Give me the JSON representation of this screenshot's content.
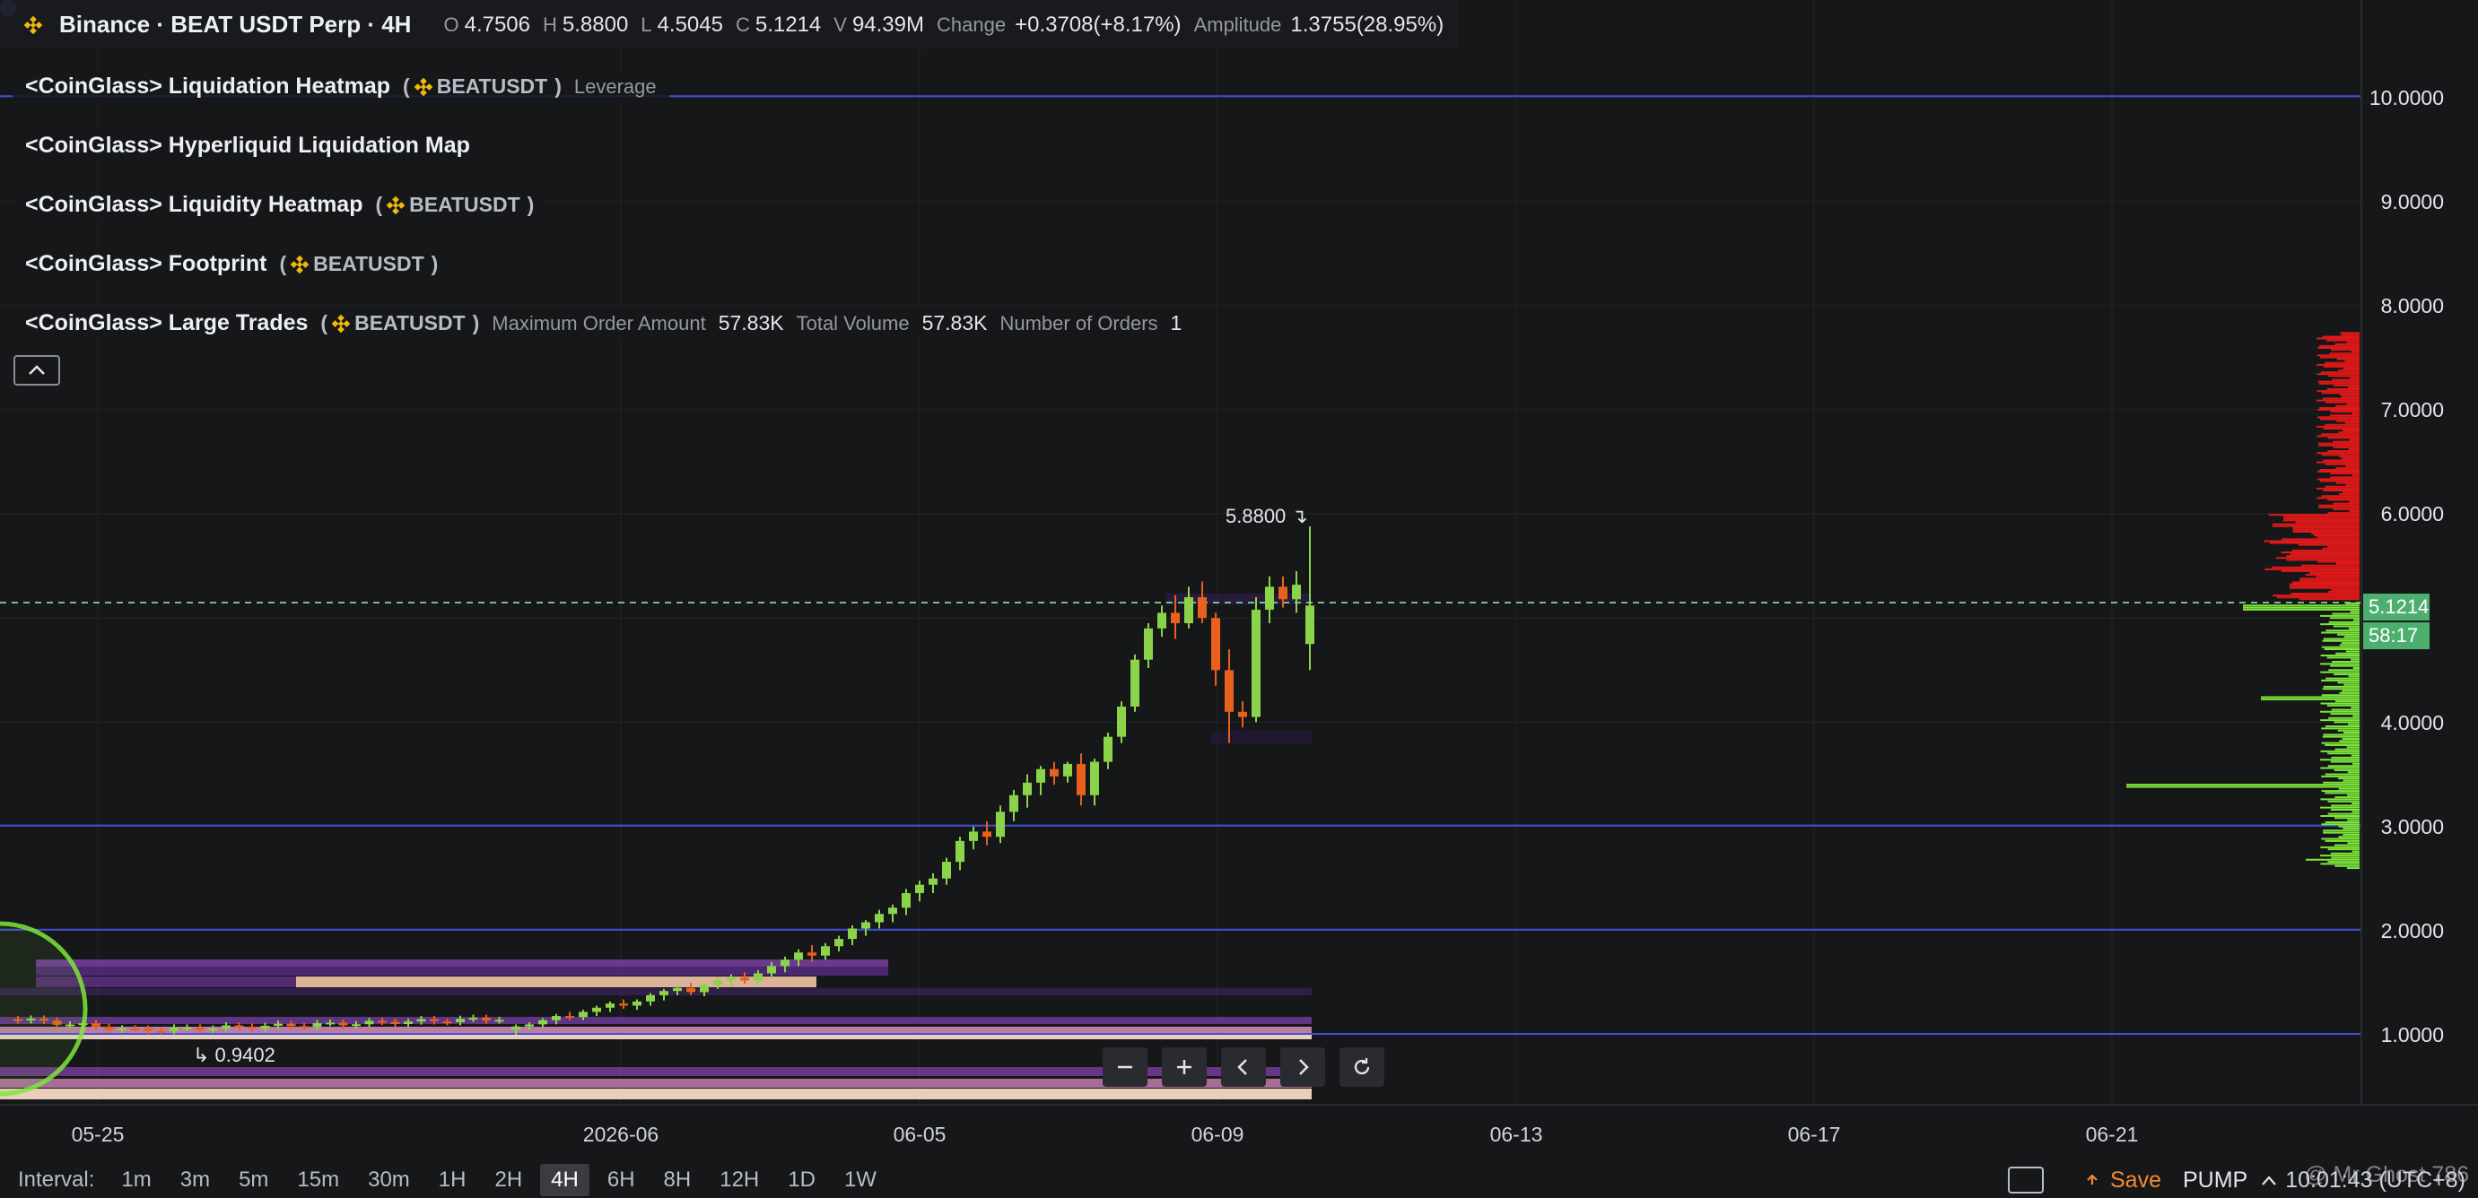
{
  "header": {
    "title": "Binance · BEAT USDT Perp · 4H",
    "open_label": "O",
    "open": "4.7506",
    "high_label": "H",
    "high": "5.8800",
    "low_label": "L",
    "low": "4.5045",
    "close_label": "C",
    "close": "5.1214",
    "volume_label": "V",
    "volume": "94.39M",
    "change_label": "Change",
    "change": "+0.3708(+8.17%)",
    "amplitude_label": "Amplitude",
    "amplitude": "1.3755(28.95%)"
  },
  "indicators": [
    {
      "name": "<CoinGlass> Liquidation Heatmap",
      "open": "(",
      "symbol": "BEATUSDT",
      "close": ")",
      "extra_label": "Leverage"
    },
    {
      "name": "<CoinGlass> Hyperliquid Liquidation Map"
    },
    {
      "name": "<CoinGlass> Liquidity Heatmap",
      "open": "(",
      "symbol": "BEATUSDT",
      "close": ")"
    },
    {
      "name": "<CoinGlass> Footprint",
      "open": "(",
      "symbol": "BEATUSDT",
      "close": ")"
    },
    {
      "name": "<CoinGlass> Large Trades",
      "open": "(",
      "symbol": "BEATUSDT",
      "close": ")",
      "max_order_label": "Maximum Order Amount",
      "max_order": "57.83K",
      "total_volume_label": "Total Volume",
      "total_volume": "57.83K",
      "orders_label": "Number of Orders",
      "orders": "1"
    }
  ],
  "price_axis": [
    "10.0000",
    "9.0000",
    "8.0000",
    "7.0000",
    "6.0000",
    "4.0000",
    "3.0000",
    "2.0000",
    "1.0000"
  ],
  "current_price": "5.1214",
  "countdown": "58:17",
  "high_marker": "5.8800",
  "low_marker": "0.9402",
  "date_axis": [
    "05-25",
    "2026-06",
    "06-05",
    "06-09",
    "06-13",
    "06-17",
    "06-21"
  ],
  "toolbar": {
    "interval_label": "Interval:",
    "intervals": [
      "1m",
      "3m",
      "5m",
      "15m",
      "30m",
      "1H",
      "2H",
      "4H",
      "6H",
      "8H",
      "12H",
      "1D",
      "1W"
    ],
    "active_interval": "4H",
    "save_label": "Save",
    "symbol": "PUMP",
    "time": "10:01:43 (UTC+8)",
    "watermark": "@ Mr Ghost 786"
  },
  "colors": {
    "up": "#8bd34a",
    "down": "#e8601c",
    "hline": "#3f4fd8",
    "bg": "#161719",
    "profile_sell": "#e01818",
    "profile_buy": "#7de83a"
  },
  "icons": [
    "binance-logo-icon",
    "collapse-icon",
    "zoom-out-icon",
    "zoom-in-icon",
    "scroll-left-icon",
    "scroll-right-icon",
    "reset-icon",
    "save-icon",
    "chevron-up-icon"
  ]
}
